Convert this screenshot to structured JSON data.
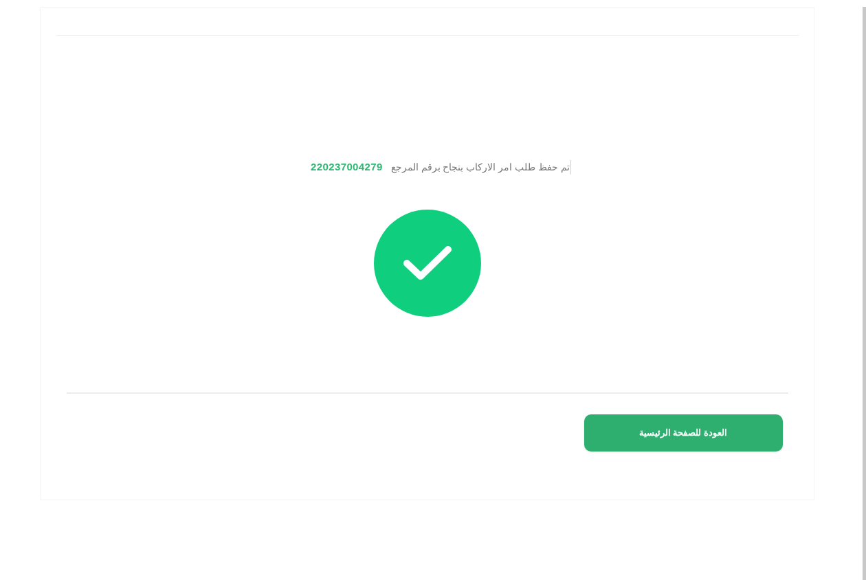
{
  "message": {
    "text": "تم حفظ طلب امر الاركاب بنجاح برقم المرجع",
    "reference": "220237004279"
  },
  "status": {
    "kind": "success"
  },
  "button": {
    "label": "العودة للصفحة الرئيسية"
  }
}
